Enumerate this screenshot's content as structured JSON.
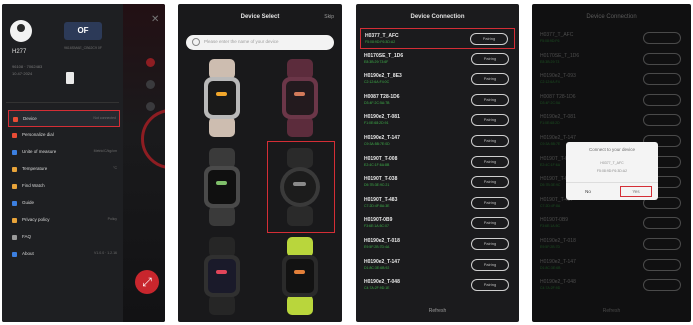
{
  "colors": {
    "highlight": "#d42e36",
    "connected_green": "#3fb04a",
    "accent_red": "#c8262d"
  },
  "phone1": {
    "user": {
      "name": "H277",
      "info1": "96108 · 7062483",
      "info2": "10.47·2024"
    },
    "watch": {
      "logo": "OF",
      "sub": "9616SMAE_CB62C9 0F"
    },
    "menu": [
      {
        "label": "Device",
        "value": "Not connected",
        "icon_color": "#e94c35",
        "selected": true
      },
      {
        "label": "Personalize dial",
        "value": "",
        "icon_color": "#e94c35",
        "selected": false
      },
      {
        "label": "Unite of measure",
        "value": "Metric/C/kg/cm",
        "icon_color": "#3c7fe0",
        "selected": false
      },
      {
        "label": "Temperature",
        "value": "°C",
        "icon_color": "#e9a43a",
        "selected": false
      },
      {
        "label": "Find Watch",
        "value": "",
        "icon_color": "#e9a43a",
        "selected": false
      },
      {
        "label": "Guide",
        "value": "",
        "icon_color": "#3c7fe0",
        "selected": false
      },
      {
        "label": "Privacy policy",
        "value": "Policy",
        "icon_color": "#e9a43a",
        "selected": false
      },
      {
        "label": "FAQ",
        "value": "",
        "icon_color": "#9a9a9a",
        "selected": false
      },
      {
        "label": "About",
        "value": "V1.0.0 · 1.2.16",
        "icon_color": "#3c7fe0",
        "selected": false
      }
    ],
    "fab_icon": "⤢"
  },
  "phone2": {
    "title": "Device Select",
    "skip": "Skip",
    "search_placeholder": "Please enter the name of your device",
    "watches": [
      {
        "strap": "#cdbdb0",
        "case": "#b9b9b9",
        "screen": "#1a1a1a",
        "accent": "#f2a72b"
      },
      {
        "strap": "#5c2c3c",
        "case": "#6b3648",
        "screen": "#231a1e",
        "accent": "#d27a5a"
      },
      {
        "strap": "#3a3a3a",
        "case": "#4a4a4a",
        "screen": "#101010",
        "accent": "#7fbf6a"
      },
      {
        "strap": "#2a2a2a",
        "case": "#3a3a3a",
        "screen": "#1c1c1c",
        "accent": "#8a8a8a"
      },
      {
        "strap": "#262626",
        "case": "#303030",
        "screen": "#1a1a2a",
        "accent": "#e2455a"
      },
      {
        "strap": "#b9d63c",
        "case": "#2a2a2a",
        "screen": "#121212",
        "accent": "#e3803a"
      }
    ]
  },
  "phone3": {
    "title": "Device Connection",
    "devices": [
      {
        "name": "H0377_T_AFC",
        "sub": "F5:08:9D:F6:3D:A2",
        "btn": "Pairing",
        "highlight": true
      },
      {
        "name": "H0170SE_T_1D6",
        "sub": "E8:3B:29:73:6F",
        "btn": "Pairing",
        "highlight": false
      },
      {
        "name": "H0190e2_T_8E3",
        "sub": "C2:12:6A:F4:0C",
        "btn": "Pairing",
        "highlight": false
      },
      {
        "name": "H0087 T28-1D6",
        "sub": "D3:4F:2C:5A:7B",
        "btn": "Pairing",
        "highlight": false
      },
      {
        "name": "H0190e2_T-081",
        "sub": "F1:0E:68:2D:91",
        "btn": "Pairing",
        "highlight": false
      },
      {
        "name": "H0190e2_T-147",
        "sub": "C9:3A:5B:7E:0D",
        "btn": "Pairing",
        "highlight": false
      },
      {
        "name": "H0190T_T-008",
        "sub": "E2:4C:1F:6A:8B",
        "btn": "Pairing",
        "highlight": false
      },
      {
        "name": "H0190T_T-038",
        "sub": "D5:7B:3E:9C:21",
        "btn": "Pairing",
        "highlight": false
      },
      {
        "name": "H0190T_T-483",
        "sub": "C7:2D:4F:8A:3E",
        "btn": "Pairing",
        "highlight": false
      },
      {
        "name": "H0190T-0B9",
        "sub": "F3:6E:1A:5C:07",
        "btn": "Pairing",
        "highlight": false
      },
      {
        "name": "H0190e2_T-018",
        "sub": "E9:5F:2B:7D:4A",
        "btn": "Pairing",
        "highlight": false
      },
      {
        "name": "H0190e2_T-147",
        "sub": "D1:8C:3E:6B:92",
        "btn": "Pairing",
        "highlight": false
      },
      {
        "name": "H0190e2_T-048",
        "sub": "C4:7A:2F:9D:1E",
        "btn": "Pairing",
        "highlight": false
      }
    ],
    "footer": "Refresh"
  },
  "phone4": {
    "title": "Device Connection",
    "devices": [
      {
        "name": "H0377_T_AFC",
        "sub": "F5:08:9D:F6"
      },
      {
        "name": "H0170SE_T_1D6",
        "sub": "E8:3B:29:73"
      },
      {
        "name": "H0190e2_T-093",
        "sub": "C2:12:6A:F4"
      },
      {
        "name": "H0087 T28-1D6",
        "sub": "D3:4F:2C:5A"
      },
      {
        "name": "H0190e2_T-081",
        "sub": "F1:0E:68:2D"
      },
      {
        "name": "H0190e2_T-147",
        "sub": "C9:3A:5B:7E"
      },
      {
        "name": "H0190T_T-008",
        "sub": "E2:4C:1F:6A"
      },
      {
        "name": "H0190T_T-038",
        "sub": "D5:7B:3E:9C"
      },
      {
        "name": "H0190T_T-487",
        "sub": "C7:2D:4F:8A"
      },
      {
        "name": "H0190T-0B9",
        "sub": "F3:6E:1A:5C"
      },
      {
        "name": "H0190e2_T-018",
        "sub": "E9:5F:2B:7D"
      },
      {
        "name": "H0190e2_T-147",
        "sub": "D1:8C:3E:6B"
      },
      {
        "name": "H0190e2_T-048",
        "sub": "C4:7A:2F:9D"
      }
    ],
    "dialog": {
      "title": "Connect to your device",
      "line1": "H0377_T_AFC",
      "line2": "F5:08:9D:F6:3D:A2",
      "no": "No",
      "yes": "Yes"
    },
    "footer": "Refresh"
  }
}
